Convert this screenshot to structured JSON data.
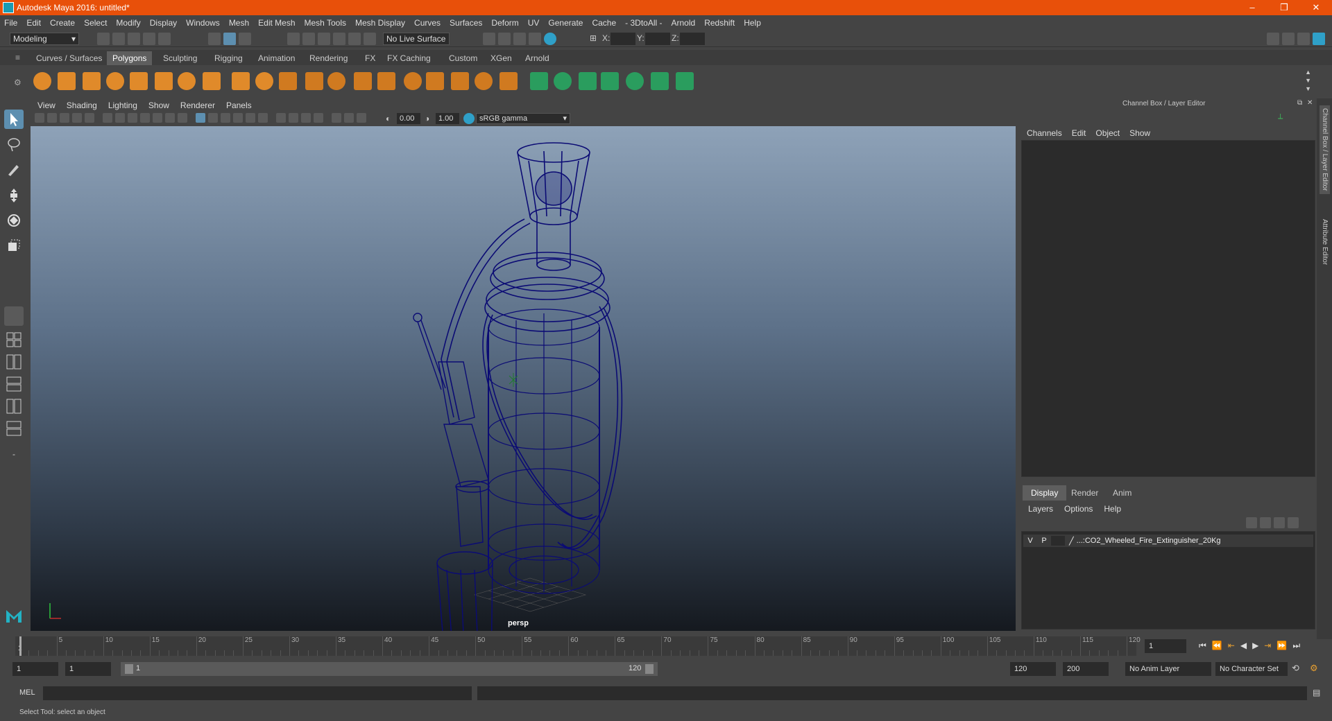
{
  "window": {
    "title": "Autodesk Maya 2016: untitled*",
    "minimize": "–",
    "maximize": "❒",
    "close": "✕"
  },
  "menus": [
    "File",
    "Edit",
    "Create",
    "Select",
    "Modify",
    "Display",
    "Windows",
    "Mesh",
    "Edit Mesh",
    "Mesh Tools",
    "Mesh Display",
    "Curves",
    "Surfaces",
    "Deform",
    "UV",
    "Generate",
    "Cache",
    "- 3DtoAll -",
    "Arnold",
    "Redshift",
    "Help"
  ],
  "statusline": {
    "menu_set": "Modeling",
    "live_surface": "No Live Surface",
    "x_label": "X:",
    "y_label": "Y:",
    "z_label": "Z:"
  },
  "shelf_tabs": [
    "Curves / Surfaces",
    "Polygons",
    "Sculpting",
    "Rigging",
    "Animation",
    "Rendering",
    "FX",
    "FX Caching",
    "Custom",
    "XGen",
    "Arnold"
  ],
  "shelf_active": "Polygons",
  "viewport": {
    "menus": [
      "View",
      "Shading",
      "Lighting",
      "Show",
      "Renderer",
      "Panels"
    ],
    "exposure": "0.00",
    "gamma": "1.00",
    "color_space": "sRGB gamma",
    "camera": "persp"
  },
  "channel_box": {
    "header": "Channel Box / Layer Editor",
    "menus": [
      "Channels",
      "Edit",
      "Object",
      "Show"
    ]
  },
  "layer_editor": {
    "tabs": [
      "Display",
      "Render",
      "Anim"
    ],
    "active_tab": "Display",
    "menus": [
      "Layers",
      "Options",
      "Help"
    ],
    "layer": {
      "v": "V",
      "p": "P",
      "name": "...:CO2_Wheeled_Fire_Extinguisher_20Kg"
    }
  },
  "side_tabs": [
    "Channel Box / Layer Editor",
    "Attribute Editor"
  ],
  "timeline": {
    "ticks": [
      5,
      10,
      15,
      20,
      25,
      30,
      35,
      40,
      45,
      50,
      55,
      60,
      65,
      70,
      75,
      80,
      85,
      90,
      95,
      100,
      105,
      110,
      115,
      120
    ],
    "start": 1,
    "end": 120,
    "current_frame": "1"
  },
  "range": {
    "start": "1",
    "playback_start": "1",
    "slider_start": "1",
    "slider_end": "120",
    "playback_end": "120",
    "end": "200",
    "anim_layer": "No Anim Layer",
    "character_set": "No Character Set"
  },
  "command": {
    "label": "MEL"
  },
  "help_line": "Select Tool: select an object",
  "colors": {
    "title_bar": "#e8500a",
    "wireframe": "#0a0a6e",
    "active_tab": "#5e5e5e"
  }
}
